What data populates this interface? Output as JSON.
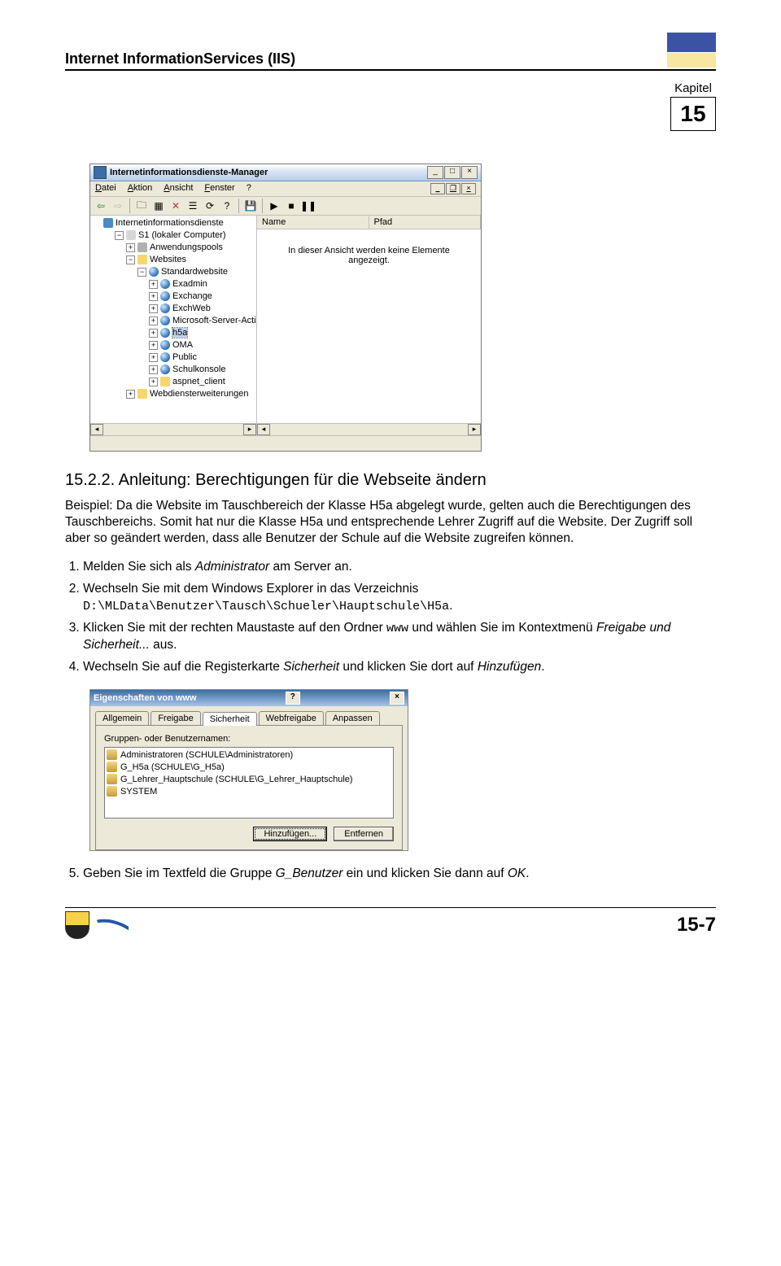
{
  "header": {
    "title": "Internet InformationServices (IIS)"
  },
  "chapter": {
    "label": "Kapitel",
    "number": "15"
  },
  "iisWindow": {
    "title": "Internetinformationsdienste-Manager",
    "menus": [
      "Datei",
      "Aktion",
      "Ansicht",
      "Fenster",
      "?"
    ],
    "tree": {
      "root": "Internetinformationsdienste",
      "server": "S1 (lokaler Computer)",
      "pools": "Anwendungspools",
      "websites": "Websites",
      "stdsite": "Standardwebsite",
      "nodes": [
        "Exadmin",
        "Exchange",
        "ExchWeb",
        "Microsoft-Server-Acti",
        "h5a",
        "OMA",
        "Public",
        "Schulkonsole",
        "aspnet_client"
      ],
      "ext": "Webdiensterweiterungen"
    },
    "listHeaders": [
      "Name",
      "Pfad"
    ],
    "emptyMsg1": "In dieser Ansicht werden keine Elemente",
    "emptyMsg2": "angezeigt."
  },
  "section": {
    "number": "15.2.2.",
    "title": "Anleitung: Berechtigungen für die Webseite ändern"
  },
  "intro1": "Beispiel: Da die Website im Tauschbereich der Klasse H5a abgelegt wurde, gelten auch die Berechtigungen des Tauschbereichs.",
  "intro2a": "Somit hat nur die Klasse H5a und entsprechende Lehrer Zugriff auf die Website. Der Zugriff soll aber so geändert werden, dass alle Benutzer der Schule auf die Website zugreifen können.",
  "steps": {
    "s1a": "Melden Sie sich als ",
    "s1b": "Administrator",
    "s1c": " am Server an.",
    "s2a": "Wechseln Sie mit dem Windows Explorer in das Verzeichnis ",
    "s2b": "D:\\MLData\\Benutzer\\Tausch\\Schueler\\Hauptschule\\H5a",
    "s2c": ".",
    "s3a": "Klicken Sie mit der rechten Maustaste auf den Ordner ",
    "s3b": "www",
    "s3c": " und wählen Sie im Kontextmenü ",
    "s3d": "Freigabe und Sicherheit...",
    "s3e": " aus.",
    "s4a": "Wechseln Sie auf die Registerkarte ",
    "s4b": "Sicherheit",
    "s4c": " und klicken Sie dort auf ",
    "s4d": "Hinzufügen",
    "s4e": "."
  },
  "propsDialog": {
    "title": "Eigenschaften von www",
    "tabs": [
      "Allgemein",
      "Freigabe",
      "Sicherheit",
      "Webfreigabe",
      "Anpassen"
    ],
    "groupLabel": "Gruppen- oder Benutzernamen:",
    "items": [
      "Administratoren (SCHULE\\Administratoren)",
      "G_H5a (SCHULE\\G_H5a)",
      "G_Lehrer_Hauptschule (SCHULE\\G_Lehrer_Hauptschule)",
      "SYSTEM"
    ],
    "btnAdd": "Hinzufügen...",
    "btnRemove": "Entfernen"
  },
  "step5": {
    "a": "Geben Sie im Textfeld die Gruppe ",
    "b": "G_Benutzer",
    "c": " ein und klicken Sie dann auf ",
    "d": "OK",
    "e": "."
  },
  "footer": {
    "pageNumber": "15-7"
  }
}
